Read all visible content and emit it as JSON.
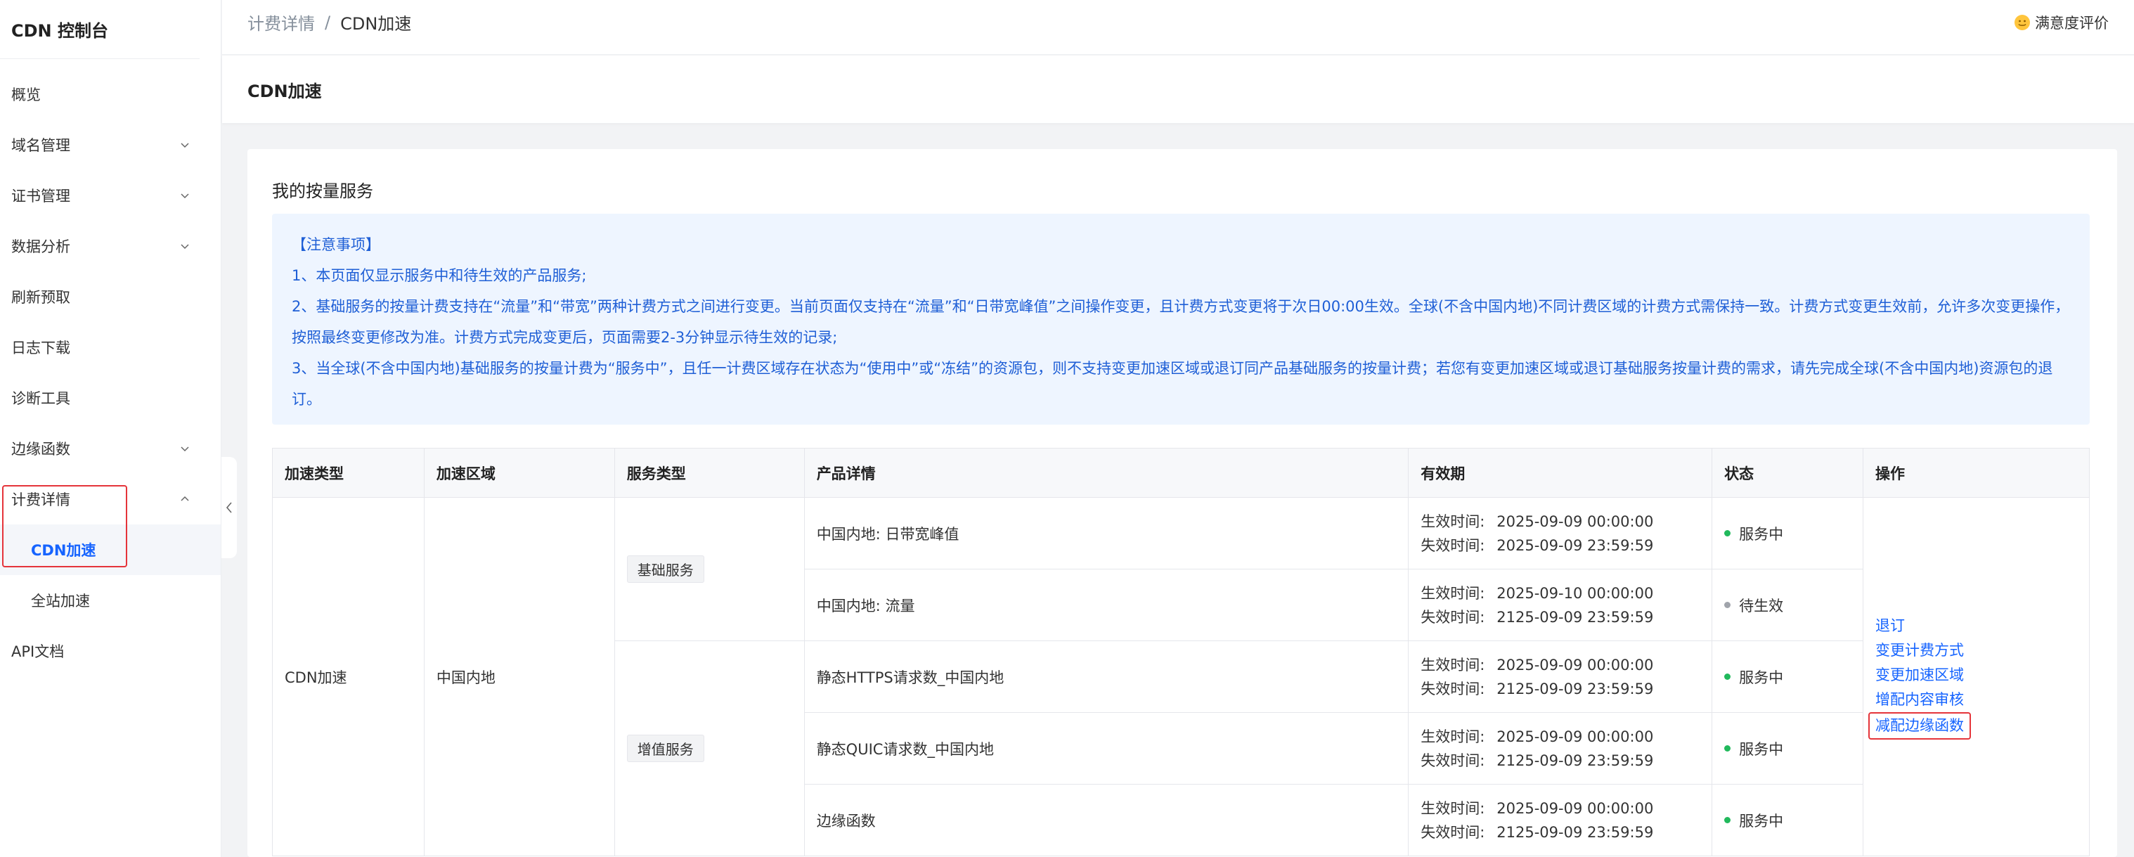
{
  "app": {
    "title": "CDN 控制台"
  },
  "sidebar": {
    "items": [
      {
        "label": "概览",
        "expandable": false
      },
      {
        "label": "域名管理",
        "expandable": true
      },
      {
        "label": "证书管理",
        "expandable": true
      },
      {
        "label": "数据分析",
        "expandable": true
      },
      {
        "label": "刷新预取",
        "expandable": false
      },
      {
        "label": "日志下载",
        "expandable": false
      },
      {
        "label": "诊断工具",
        "expandable": false
      },
      {
        "label": "边缘函数",
        "expandable": true
      },
      {
        "label": "计费详情",
        "expandable": true,
        "expanded": true
      },
      {
        "label": "CDN加速",
        "sub": true,
        "active": true
      },
      {
        "label": "全站加速",
        "sub": true
      },
      {
        "label": "API文档",
        "expandable": false
      }
    ]
  },
  "header": {
    "breadcrumb": [
      "计费详情",
      "CDN加速"
    ],
    "separator": "/",
    "rating_label": "满意度评价"
  },
  "page": {
    "title": "CDN加速"
  },
  "card": {
    "title": "我的按量服务",
    "notice": {
      "heading": "【注意事项】",
      "lines": [
        "1、本页面仅显示服务中和待生效的产品服务;",
        "2、基础服务的按量计费支持在“流量”和“带宽”两种计费方式之间进行变更。当前页面仅支持在“流量”和“日带宽峰值”之间操作变更，且计费方式变更将于次日00:00生效。全球(不含中国内地)不同计费区域的计费方式需保持一致。计费方式变更生效前，允许多次变更操作，按照最终变更修改为准。计费方式完成变更后，页面需要2-3分钟显示待生效的记录;",
        "3、当全球(不含中国内地)基础服务的按量计费为“服务中”，且任一计费区域存在状态为“使用中”或“冻结”的资源包，则不支持变更加速区域或退订同产品基础服务的按量计费；若您有变更加速区域或退订基础服务按量计费的需求，请先完成全球(不含中国内地)资源包的退订。"
      ]
    }
  },
  "table": {
    "headers": [
      "加速类型",
      "加速区域",
      "服务类型",
      "产品详情",
      "有效期",
      "状态",
      "操作"
    ],
    "accel_type": "CDN加速",
    "region": "中国内地",
    "service_groups": [
      "基础服务",
      "增值服务"
    ],
    "start_label": "生效时间:",
    "end_label": "失效时间:",
    "rows": [
      {
        "product": "中国内地: 日带宽峰值",
        "start": "2025-09-09 00:00:00",
        "end": "2025-09-09 23:59:59",
        "status": "服务中",
        "status_color": "#21b95c"
      },
      {
        "product": "中国内地: 流量",
        "start": "2025-09-10 00:00:00",
        "end": "2125-09-09 23:59:59",
        "status": "待生效",
        "status_color": "#a0a4ab"
      },
      {
        "product": "静态HTTPS请求数_中国内地",
        "start": "2025-09-09 00:00:00",
        "end": "2125-09-09 23:59:59",
        "status": "服务中",
        "status_color": "#21b95c"
      },
      {
        "product": "静态QUIC请求数_中国内地",
        "start": "2025-09-09 00:00:00",
        "end": "2125-09-09 23:59:59",
        "status": "服务中",
        "status_color": "#21b95c"
      },
      {
        "product": "边缘函数",
        "start": "2025-09-09 00:00:00",
        "end": "2125-09-09 23:59:59",
        "status": "服务中",
        "status_color": "#21b95c"
      }
    ],
    "actions": [
      "退订",
      "变更计费方式",
      "变更加速区域",
      "增配内容审核",
      "减配边缘函数"
    ]
  },
  "colors": {
    "accent": "#1664ff",
    "highlight": "#e5343a",
    "notice_bg": "#eef5ff"
  }
}
